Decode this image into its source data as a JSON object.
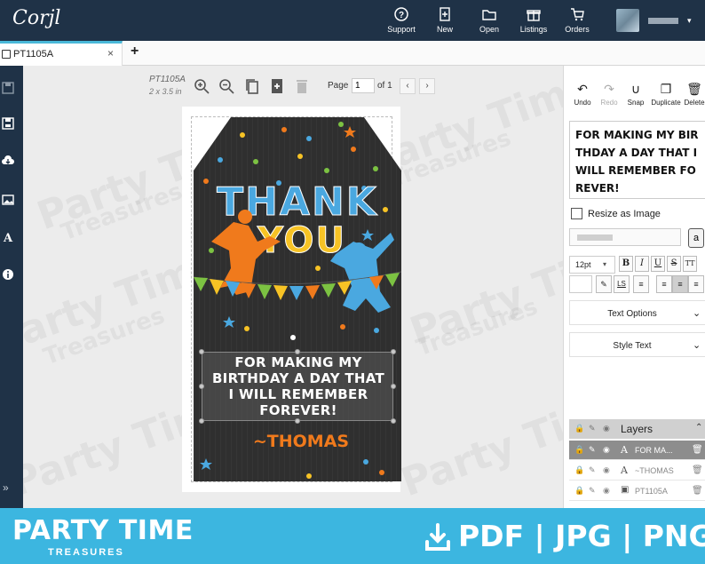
{
  "app": {
    "logo": "Corjl"
  },
  "nav": [
    {
      "label": "Support",
      "icon": "help-circle-icon"
    },
    {
      "label": "New",
      "icon": "new-file-icon"
    },
    {
      "label": "Open",
      "icon": "folder-icon"
    },
    {
      "label": "Listings",
      "icon": "gift-icon"
    },
    {
      "label": "Orders",
      "icon": "cart-icon"
    }
  ],
  "tab": {
    "label": "PT1105A",
    "close": "×",
    "add": "+"
  },
  "canvas": {
    "doc_name": "PT1105A",
    "doc_size": "2 x 3.5 in",
    "page_label": "Page",
    "page_value": "1",
    "page_of": "of 1",
    "prev": "‹",
    "next": "›"
  },
  "design": {
    "thank": "THANK",
    "you": "YOU",
    "message_lines": [
      "FOR MAKING MY",
      "BIRTHDAY A DAY THAT",
      "I WILL REMEMBER",
      "FOREVER!"
    ],
    "signature": "~THOMAS",
    "colors": {
      "board": "#2f2f2f",
      "orange": "#f07a1c",
      "blue": "#4aa8e0",
      "green": "#7cc242",
      "yellow": "#f7c325"
    }
  },
  "watermark": {
    "line1": "Party Time",
    "line2": "Treasures"
  },
  "right_panel": {
    "tools": [
      {
        "label": "Undo",
        "icon": "undo-icon"
      },
      {
        "label": "Redo",
        "icon": "redo-icon"
      },
      {
        "label": "Snap",
        "icon": "magnet-icon"
      },
      {
        "label": "Duplicate",
        "icon": "duplicate-icon"
      },
      {
        "label": "Delete",
        "icon": "trash-icon"
      }
    ],
    "text_value": "FOR MAKING MY BIRTHDAY A DAY THAT I WILL REMEMBER FOREVER!",
    "resize_label": "Resize as Image",
    "font_size": "12pt",
    "text_options": "Text Options",
    "style_text": "Style Text",
    "layers_title": "Layers",
    "layers": [
      {
        "name": "FOR MA...",
        "type": "A",
        "selected": true
      },
      {
        "name": "~THOMAS",
        "type": "A",
        "selected": false
      },
      {
        "name": "PT1105A",
        "type": "img",
        "selected": false
      }
    ]
  },
  "banner": {
    "brand_line1": "PARTY TIME",
    "brand_line2": "TREASURES",
    "formats": "PDF | JPG | PNG"
  }
}
